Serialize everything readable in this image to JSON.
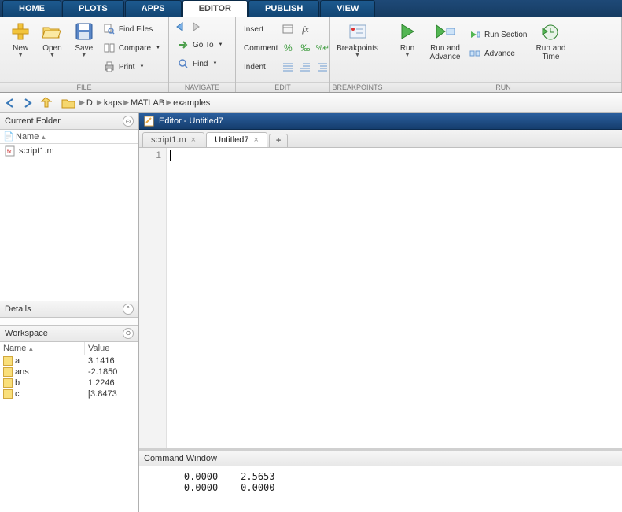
{
  "ribbon": {
    "tabs": [
      "HOME",
      "PLOTS",
      "APPS",
      "EDITOR",
      "PUBLISH",
      "VIEW"
    ],
    "active": "EDITOR"
  },
  "toolstrip": {
    "groups": {
      "file": {
        "label": "FILE",
        "new": "New",
        "open": "Open",
        "save": "Save",
        "find_files": "Find Files",
        "compare": "Compare",
        "print": "Print"
      },
      "navigate": {
        "label": "NAVIGATE",
        "goto": "Go To",
        "find": "Find"
      },
      "edit": {
        "label": "EDIT",
        "insert": "Insert",
        "comment": "Comment",
        "indent": "Indent"
      },
      "breakpoints": {
        "label": "BREAKPOINTS",
        "breakpoints": "Breakpoints"
      },
      "run": {
        "label": "RUN",
        "run": "Run",
        "run_advance": "Run and\nAdvance",
        "run_section": "Run Section",
        "advance": "Advance",
        "run_time": "Run and\nTime"
      }
    }
  },
  "breadcrumb": [
    "D:",
    "kaps",
    "MATLAB",
    "examples"
  ],
  "panels": {
    "current_folder": {
      "title": "Current Folder",
      "header_name": "Name",
      "files": [
        "script1.m"
      ]
    },
    "details": {
      "title": "Details"
    },
    "workspace": {
      "title": "Workspace",
      "header_name": "Name",
      "header_value": "Value",
      "vars": [
        {
          "name": "a",
          "value": "3.1416"
        },
        {
          "name": "ans",
          "value": "-2.1850"
        },
        {
          "name": "b",
          "value": "1.2246"
        },
        {
          "name": "c",
          "value": "[3.8473"
        }
      ]
    }
  },
  "editor": {
    "title": "Editor - Untitled7",
    "tabs": [
      {
        "label": "script1.m",
        "active": false
      },
      {
        "label": "Untitled7",
        "active": true
      }
    ],
    "line_number": "1"
  },
  "command_window": {
    "title": "Command Window",
    "output": "    0.0000    2.5653\n    0.0000    0.0000"
  }
}
